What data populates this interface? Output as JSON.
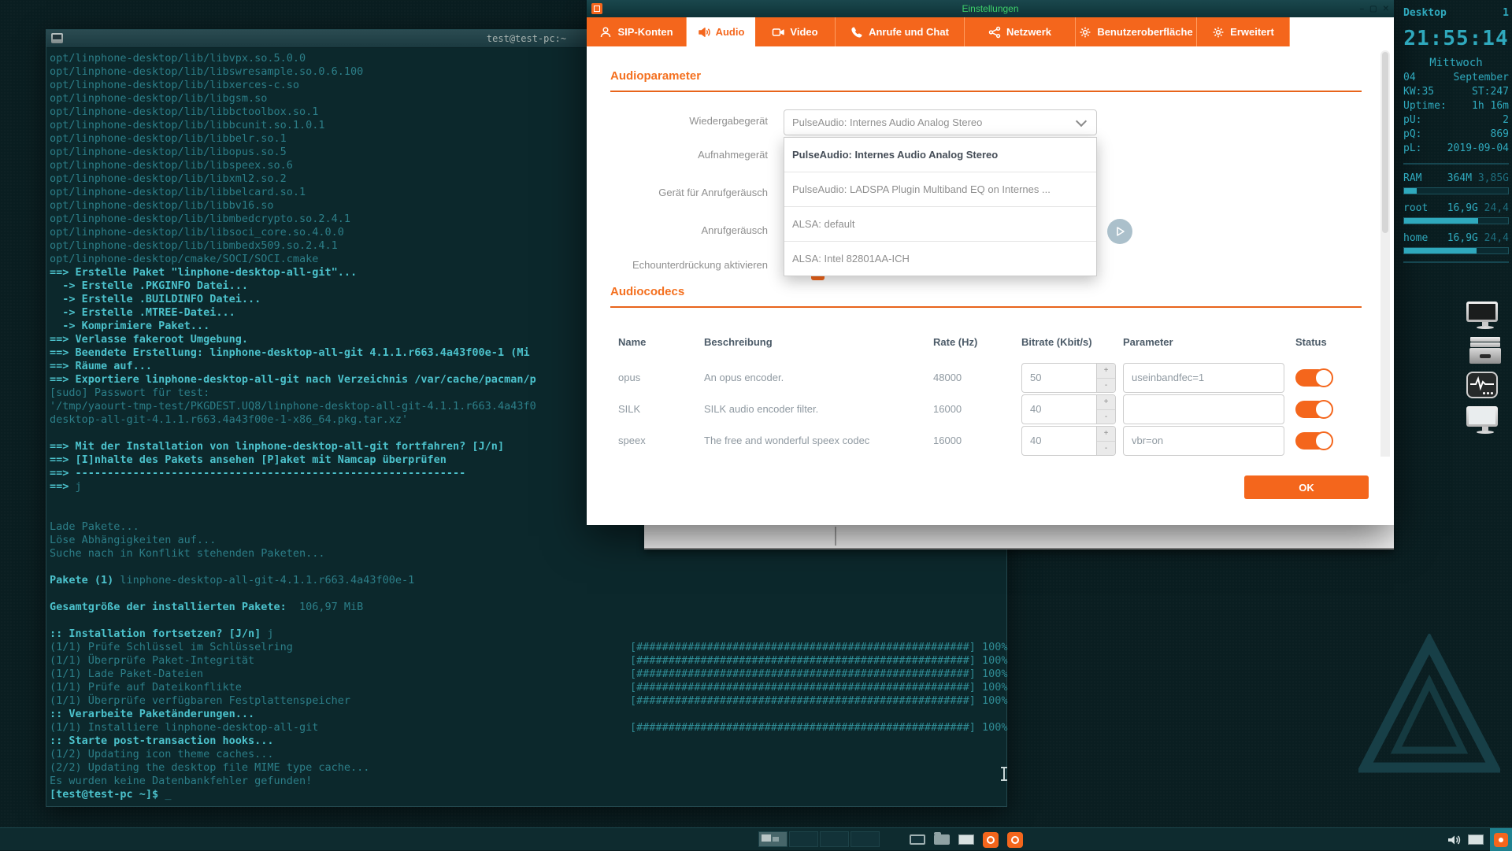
{
  "colors": {
    "accent": "#f4661c",
    "terminal_dim": "#2c7e88",
    "terminal_bright": "#4cc2cc",
    "conky": "#2fa9bd",
    "title_green": "#3ecf6a"
  },
  "dialog": {
    "title": "Einstellungen",
    "tabs": [
      {
        "label": "SIP-Konten",
        "icon": "person-icon",
        "active": false
      },
      {
        "label": "Audio",
        "icon": "speaker-icon",
        "active": true
      },
      {
        "label": "Video",
        "icon": "video-camera-icon",
        "active": false
      },
      {
        "label": "Anrufe und Chat",
        "icon": "phone-icon",
        "active": false
      },
      {
        "label": "Netzwerk",
        "icon": "network-icon",
        "active": false
      },
      {
        "label": "Benutzeroberfläche",
        "icon": "gear-icon",
        "active": false
      },
      {
        "label": "Erweitert",
        "icon": "gear-icon",
        "active": false
      }
    ],
    "audio_params": {
      "heading": "Audioparameter",
      "rows": [
        "Wiedergabegerät",
        "Aufnahmegerät",
        "Gerät für Anrufgeräusch",
        "Anrufgeräusch",
        "Echounterdrückung aktivieren"
      ],
      "playback_value": "PulseAudio: Internes Audio Analog Stereo",
      "dropdown_options": [
        {
          "label": "PulseAudio: Internes Audio Analog Stereo",
          "selected": true
        },
        {
          "label": "PulseAudio: LADSPA Plugin Multiband EQ on Internes ...",
          "selected": false
        },
        {
          "label": "ALSA: default",
          "selected": false
        },
        {
          "label": "ALSA: Intel 82801AA-ICH",
          "selected": false
        }
      ]
    },
    "audio_codecs": {
      "heading": "Audiocodecs",
      "headers": [
        "Name",
        "Beschreibung",
        "Rate (Hz)",
        "Bitrate (Kbit/s)",
        "Parameter",
        "Status"
      ],
      "rows": [
        {
          "name": "opus",
          "description": "An opus encoder.",
          "rate": "48000",
          "bitrate": "50",
          "parameter": "useinbandfec=1",
          "enabled": true
        },
        {
          "name": "SILK",
          "description": "SILK audio encoder filter.",
          "rate": "16000",
          "bitrate": "40",
          "parameter": "",
          "enabled": true
        },
        {
          "name": "speex",
          "description": "The free and wonderful speex codec",
          "rate": "16000",
          "bitrate": "40",
          "parameter": "vbr=on",
          "enabled": true
        }
      ]
    },
    "ok_label": "OK"
  },
  "terminal": {
    "title": "test@test-pc:~",
    "bar_text": "[####################################################] 100%",
    "lines": [
      {
        "seg": [
          [
            "opt/linphone-desktop/lib/libvpx.so.5.0.0",
            "d"
          ]
        ]
      },
      {
        "seg": [
          [
            "opt/linphone-desktop/lib/libswresample.so.0.6.100",
            "d"
          ]
        ]
      },
      {
        "seg": [
          [
            "opt/linphone-desktop/lib/libxerces-c.so",
            "d"
          ]
        ]
      },
      {
        "seg": [
          [
            "opt/linphone-desktop/lib/libgsm.so",
            "d"
          ]
        ]
      },
      {
        "seg": [
          [
            "opt/linphone-desktop/lib/libbctoolbox.so.1",
            "d"
          ]
        ]
      },
      {
        "seg": [
          [
            "opt/linphone-desktop/lib/libbcunit.so.1.0.1",
            "d"
          ]
        ]
      },
      {
        "seg": [
          [
            "opt/linphone-desktop/lib/libbelr.so.1",
            "d"
          ]
        ]
      },
      {
        "seg": [
          [
            "opt/linphone-desktop/lib/libopus.so.5",
            "d"
          ]
        ]
      },
      {
        "seg": [
          [
            "opt/linphone-desktop/lib/libspeex.so.6",
            "d"
          ]
        ]
      },
      {
        "seg": [
          [
            "opt/linphone-desktop/lib/libxml2.so.2",
            "d"
          ]
        ]
      },
      {
        "seg": [
          [
            "opt/linphone-desktop/lib/libbelcard.so.1",
            "d"
          ]
        ]
      },
      {
        "seg": [
          [
            "opt/linphone-desktop/lib/libbv16.so",
            "d"
          ]
        ]
      },
      {
        "seg": [
          [
            "opt/linphone-desktop/lib/libmbedcrypto.so.2.4.1",
            "d"
          ]
        ]
      },
      {
        "seg": [
          [
            "opt/linphone-desktop/lib/libsoci_core.so.4.0.0",
            "d"
          ]
        ]
      },
      {
        "seg": [
          [
            "opt/linphone-desktop/lib/libmbedx509.so.2.4.1",
            "d"
          ]
        ]
      },
      {
        "seg": [
          [
            "opt/linphone-desktop/cmake/SOCI/SOCI.cmake",
            "d"
          ]
        ]
      },
      {
        "seg": [
          [
            "==> Erstelle Paket \"linphone-desktop-all-git\"...",
            "b"
          ]
        ]
      },
      {
        "seg": [
          [
            "  -> Erstelle .PKGINFO Datei...",
            "b"
          ]
        ]
      },
      {
        "seg": [
          [
            "  -> Erstelle .BUILDINFO Datei...",
            "b"
          ]
        ]
      },
      {
        "seg": [
          [
            "  -> Erstelle .MTREE-Datei...",
            "b"
          ]
        ]
      },
      {
        "seg": [
          [
            "  -> Komprimiere Paket...",
            "b"
          ]
        ]
      },
      {
        "seg": [
          [
            "==> Verlasse fakeroot Umgebung.",
            "b"
          ]
        ]
      },
      {
        "seg": [
          [
            "==> Beendete Erstellung: linphone-desktop-all-git 4.1.1.r663.4a43f00e-1 (Mi",
            "b"
          ]
        ]
      },
      {
        "seg": [
          [
            "==> Räume auf...",
            "b"
          ]
        ]
      },
      {
        "seg": [
          [
            "==> Exportiere linphone-desktop-all-git nach Verzeichnis /var/cache/pacman/p",
            "b"
          ]
        ]
      },
      {
        "seg": [
          [
            "[sudo] Passwort für test:",
            "d"
          ]
        ]
      },
      {
        "seg": [
          [
            "'/tmp/yaourt-tmp-test/PKGDEST.UQ8/linphone-desktop-all-git-4.1.1.r663.4a43f0",
            "d"
          ]
        ]
      },
      {
        "seg": [
          [
            "desktop-all-git-4.1.1.r663.4a43f00e-1-x86_64.pkg.tar.xz'",
            "d"
          ]
        ]
      },
      {
        "seg": []
      },
      {
        "seg": [
          [
            "==> Mit der Installation von linphone-desktop-all-git fortfahren? [J/n]",
            "b"
          ]
        ]
      },
      {
        "seg": [
          [
            "==> [I]nhalte des Pakets ansehen [P]aket mit Namcap überprüfen",
            "b"
          ]
        ]
      },
      {
        "seg": [
          [
            "==> -------------------------------------------------------------",
            "b"
          ]
        ]
      },
      {
        "seg": [
          [
            "==> ",
            "b"
          ],
          [
            "j",
            "d"
          ]
        ]
      },
      {
        "seg": []
      },
      {
        "seg": []
      },
      {
        "seg": [
          [
            "Lade Pakete...",
            "d"
          ]
        ]
      },
      {
        "seg": [
          [
            "Löse Abhängigkeiten auf...",
            "d"
          ]
        ]
      },
      {
        "seg": [
          [
            "Suche nach in Konflikt stehenden Paketen...",
            "d"
          ]
        ]
      },
      {
        "seg": []
      },
      {
        "seg": [
          [
            "Pakete (1) ",
            "b"
          ],
          [
            "linphone-desktop-all-git-4.1.1.r663.4a43f00e-1",
            "d"
          ]
        ]
      },
      {
        "seg": []
      },
      {
        "seg": [
          [
            "Gesamtgröße der installierten Pakete:",
            "b"
          ],
          [
            "  106,97 MiB",
            "d"
          ]
        ]
      },
      {
        "seg": []
      },
      {
        "seg": [
          [
            ":: Installation fortsetzen? [J/n] ",
            "b"
          ],
          [
            "j",
            "d"
          ]
        ]
      },
      {
        "seg": [
          [
            "(1/1) Prüfe Schlüssel im Schlüsselring",
            "d"
          ]
        ],
        "bar": true
      },
      {
        "seg": [
          [
            "(1/1) Überprüfe Paket-Integrität",
            "d"
          ]
        ],
        "bar": true
      },
      {
        "seg": [
          [
            "(1/1) Lade Paket-Dateien",
            "d"
          ]
        ],
        "bar": true
      },
      {
        "seg": [
          [
            "(1/1) Prüfe auf Dateikonflikte",
            "d"
          ]
        ],
        "bar": true
      },
      {
        "seg": [
          [
            "(1/1) Überprüfe verfügbaren Festplattenspeicher",
            "d"
          ]
        ],
        "bar": true
      },
      {
        "seg": [
          [
            ":: Verarbeite Paketänderungen...",
            "b"
          ]
        ]
      },
      {
        "seg": [
          [
            "(1/1) Installiere linphone-desktop-all-git",
            "d"
          ]
        ],
        "bar": true
      },
      {
        "seg": [
          [
            ":: Starte post-transaction hooks...",
            "b"
          ]
        ]
      },
      {
        "seg": [
          [
            "(1/2) Updating icon theme caches...",
            "d"
          ]
        ]
      },
      {
        "seg": [
          [
            "(2/2) Updating the desktop file MIME type cache...",
            "d"
          ]
        ]
      },
      {
        "seg": [
          [
            "Es wurden keine Datenbankfehler gefunden!",
            "d"
          ]
        ]
      },
      {
        "seg": [
          [
            "[test@test-pc ~]$ ",
            "b"
          ],
          [
            "_",
            "d"
          ]
        ]
      }
    ]
  },
  "conky": {
    "header": {
      "left": "Desktop",
      "right": "1"
    },
    "clock": "21:55:14",
    "weekday": "Mittwoch",
    "rows": [
      {
        "l": "04",
        "r": "September"
      },
      {
        "l": "KW:35",
        "r": "ST:247"
      },
      {
        "l": "Uptime:",
        "r": "1h 16m"
      },
      {
        "l": "pU:",
        "r": "2"
      },
      {
        "l": "pQ:",
        "r": "869"
      },
      {
        "l": "pL:",
        "r": "2019-09-04"
      }
    ],
    "meters": [
      {
        "label": "RAM",
        "v1": "364M",
        "v2": "3,85G",
        "pct": 12
      },
      {
        "label": "root",
        "v1": "16,9G",
        "v2": "24,4",
        "pct": 71
      },
      {
        "label": "home",
        "v1": "16,9G",
        "v2": "24,4",
        "pct": 70
      }
    ]
  },
  "taskbar": {
    "workspaces": 4,
    "active_workspace": 1,
    "launcher_icons": [
      "monitor-icon",
      "folder-icon",
      "display-icon",
      "app-orange-icon",
      "app-orange-icon"
    ],
    "tray_icons": [
      "volume-icon",
      "display-icon",
      "settings-orange-icon"
    ]
  },
  "desktop_icons": [
    "monitor-icon",
    "file-cabinet-icon",
    "system-monitor-icon",
    "display-light-icon"
  ]
}
